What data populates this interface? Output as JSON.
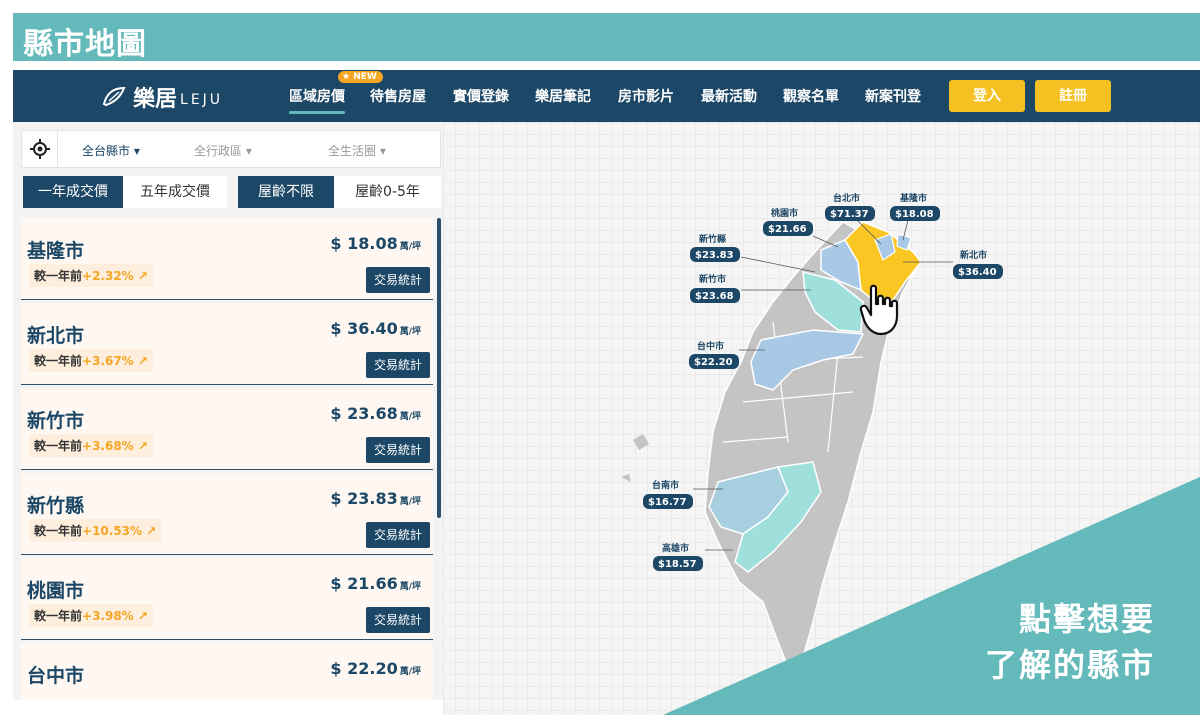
{
  "banner": {
    "title": "縣市地圖"
  },
  "header": {
    "logo_cn": "樂居",
    "logo_en": "LEJU",
    "new_badge": "NEW",
    "nav": [
      "區域房價",
      "待售房屋",
      "實價登錄",
      "樂居筆記",
      "房市影片",
      "最新活動",
      "觀察名單",
      "新案刊登"
    ],
    "login": "登入",
    "register": "註冊"
  },
  "filters": {
    "county": "全台縣市 ▾",
    "district": "全行政區 ▾",
    "lifezone": "全生活圈 ▾"
  },
  "toggles": {
    "period_1y": "一年成交價",
    "period_5y": "五年成交價",
    "age_any": "屋齡不限",
    "age_0_5": "屋齡0-5年"
  },
  "list": [
    {
      "city": "基隆市",
      "price": "$ 18.08",
      "unit": "萬/坪",
      "change_label": "較一年前",
      "change": "+2.32%",
      "button": "交易統計"
    },
    {
      "city": "新北市",
      "price": "$ 36.40",
      "unit": "萬/坪",
      "change_label": "較一年前",
      "change": "+3.67%",
      "button": "交易統計"
    },
    {
      "city": "新竹市",
      "price": "$ 23.68",
      "unit": "萬/坪",
      "change_label": "較一年前",
      "change": "+3.68%",
      "button": "交易統計"
    },
    {
      "city": "新竹縣",
      "price": "$ 23.83",
      "unit": "萬/坪",
      "change_label": "較一年前",
      "change": "+10.53%",
      "button": "交易統計"
    },
    {
      "city": "桃園市",
      "price": "$ 21.66",
      "unit": "萬/坪",
      "change_label": "較一年前",
      "change": "+3.98%",
      "button": "交易統計"
    },
    {
      "city": "台中市",
      "price": "$ 22.20",
      "unit": "萬/坪",
      "change_label": "",
      "change": "",
      "button": ""
    }
  ],
  "map_labels": {
    "taipei": {
      "name": "台北市",
      "price": "$71.37"
    },
    "keelung": {
      "name": "基隆市",
      "price": "$18.08"
    },
    "taoyuan": {
      "name": "桃園市",
      "price": "$21.66"
    },
    "hsinchu_county": {
      "name": "新竹縣",
      "price": "$23.83"
    },
    "new_taipei": {
      "name": "新北市",
      "price": "$36.40"
    },
    "hsinchu_city": {
      "name": "新竹市",
      "price": "$23.68"
    },
    "taichung": {
      "name": "台中市",
      "price": "$22.20"
    },
    "tainan": {
      "name": "台南市",
      "price": "$16.77"
    },
    "kaohsiung": {
      "name": "高雄市",
      "price": "$18.57"
    }
  },
  "overlay": {
    "line1": "點擊想要",
    "line2": "了解的縣市"
  },
  "colors": {
    "navy": "#1c4766",
    "teal": "#64b9bb",
    "gold": "#f5c021",
    "orange": "#f5a623",
    "light_blue": "#a8c8e6",
    "mint": "#9fe0dc",
    "gray": "#c4c4c4",
    "yellow": "#f9c623"
  },
  "icons": {
    "locate": "crosshair-icon",
    "pointer": "hand-pointer-icon",
    "trend": "trend-up-icon"
  }
}
